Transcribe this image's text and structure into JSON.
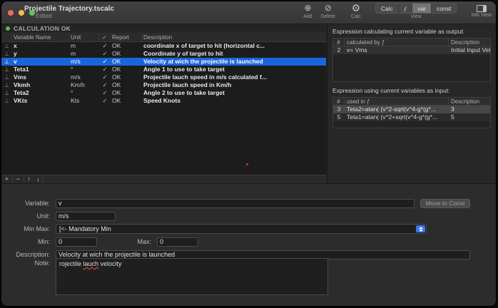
{
  "window": {
    "title": "Projectile Trajectory.tscalc",
    "subtitle": "Edited"
  },
  "toolbar": {
    "add_icon": "⊕",
    "add_label": "Add",
    "delete_icon": "⊘",
    "delete_label": "Delete",
    "gear_icon": "⚙",
    "calc_label": "Calc",
    "segments": [
      "Calc",
      "ƒ",
      "var",
      "const"
    ],
    "selected_segment": "var",
    "view_label": "View",
    "info_label": "Info View"
  },
  "left": {
    "status": "CALCULATION OK",
    "table": {
      "headers": {
        "name": "Variable Name",
        "unit": "Unit",
        "check": "✓",
        "report": "Report",
        "description": "Description"
      },
      "rows": [
        {
          "icon": "⊥",
          "name": "x",
          "unit": "m",
          "check": "✓",
          "report": "OK",
          "desc": "coordinate x of target to hit (horizontal c..."
        },
        {
          "icon": "⊥",
          "name": "y",
          "unit": "m",
          "check": "✓",
          "report": "OK",
          "desc": "Coordinate y of target to hit"
        },
        {
          "icon": "⊥",
          "name": "v",
          "unit": "m/s",
          "check": "✓",
          "report": "OK",
          "desc": "Velocity at wich the projectile is launched"
        },
        {
          "icon": "⊥",
          "name": "Teta1",
          "unit": "°",
          "check": "✓",
          "report": "OK",
          "desc": "Angle 1 to use to take target"
        },
        {
          "icon": "⊥",
          "name": "Vms",
          "unit": "m/s",
          "check": "✓",
          "report": "OK",
          "desc": "Projectile lauch speed in m/s calculated f..."
        },
        {
          "icon": "⊥",
          "name": "Vkmh",
          "unit": "Km/h",
          "check": "✓",
          "report": "OK",
          "desc": "Projectile lauch speed in Km/h"
        },
        {
          "icon": "⊥",
          "name": "Teta2",
          "unit": "°",
          "check": "✓",
          "report": "OK",
          "desc": "Angle 2 to use to take target"
        },
        {
          "icon": "⊥",
          "name": "VKts",
          "unit": "Kts",
          "check": "✓",
          "report": "OK",
          "desc": "Speed Knots"
        }
      ]
    },
    "row_toolbar": {
      "add": "+",
      "remove": "−",
      "up": "↑",
      "down": "↓"
    }
  },
  "form": {
    "variable_label": "Variable:",
    "variable_value": "v",
    "move_to_const_label": "Move to Const",
    "unit_label": "Unit:",
    "unit_value": "m/s",
    "minmax_label": "Min Max:",
    "minmax_value": "[<- Mandatory Min",
    "min_label": "Min:",
    "min_value": "0",
    "max_label": "Max:",
    "max_value": "0",
    "description_label": "Description:",
    "description_value": "Velocity at wich the projectile is launched",
    "note_label": "Note:",
    "note": {
      "pre": "rojectile ",
      "misspelled": "lauch",
      "post": " velocity"
    }
  },
  "right": {
    "output_section": {
      "title": "Expression calculating current variable as output:",
      "headers": {
        "num": "#",
        "formula": "calculated by ƒ",
        "description": "Description"
      },
      "rows": [
        {
          "num": "2",
          "formula": "v= Vms",
          "description": "Initial Input Velocity of pr..."
        }
      ]
    },
    "input_section": {
      "title": "Expression using current variables as input:",
      "headers": {
        "num": "#",
        "formula": "used in ƒ",
        "description": "Description"
      },
      "rows": [
        {
          "num": "3",
          "formula": "Teta2=atan( (v^2-sqrt(v^4-g*(g*...",
          "description": "3"
        },
        {
          "num": "5",
          "formula": "Teta1=atan( (v^2+sqrt(v^4-g*(g*...",
          "description": "5"
        }
      ]
    }
  },
  "colors": {
    "selection_blue": "#1a66d9",
    "popup_chevron_blue": "#3575f0",
    "status_green": "#4fc14f"
  }
}
